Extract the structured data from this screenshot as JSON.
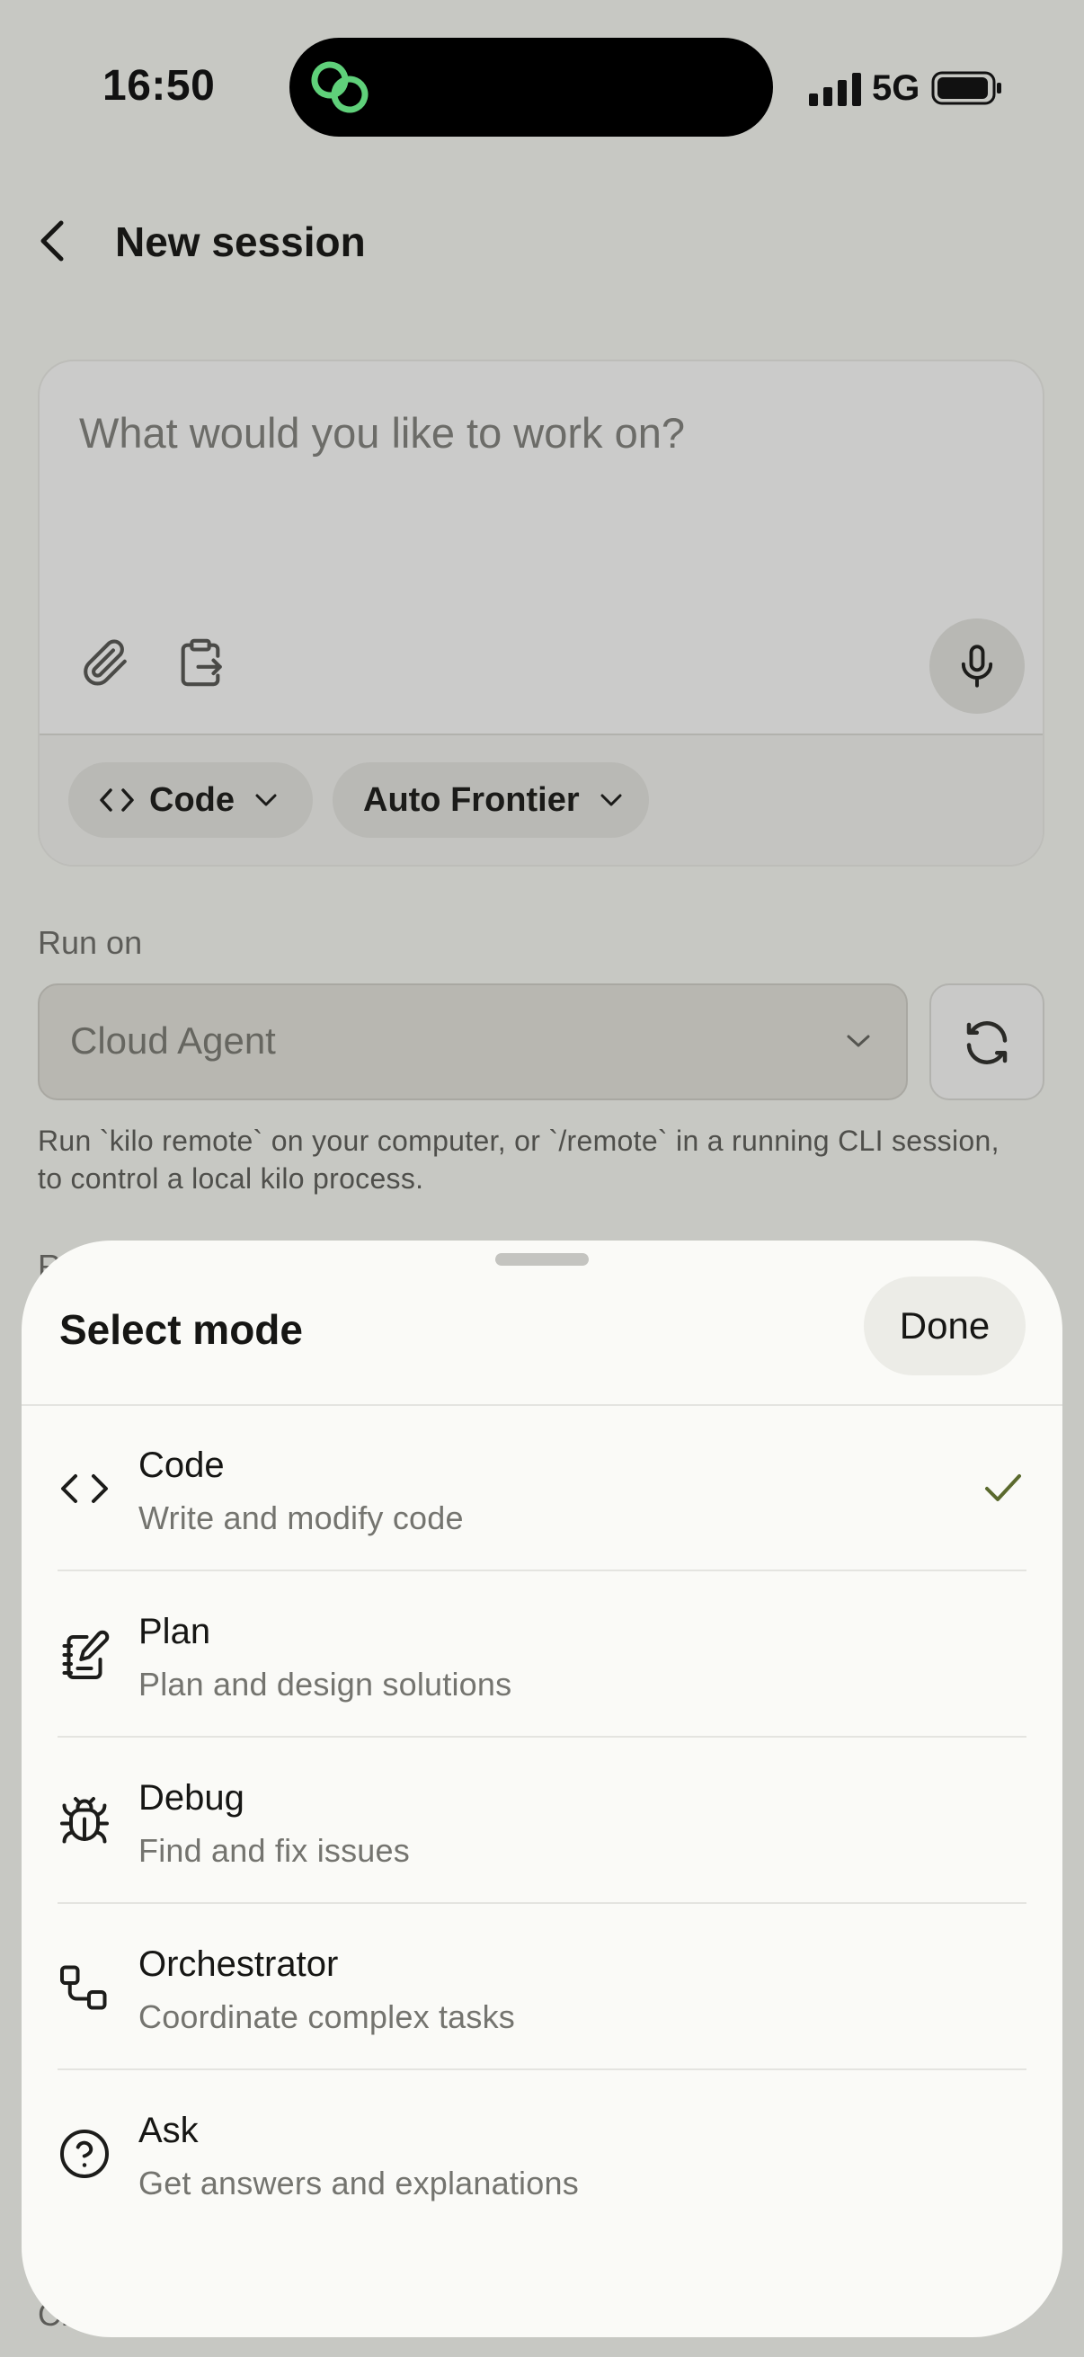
{
  "status_bar": {
    "time": "16:50",
    "network": "5G"
  },
  "header": {
    "title": "New session"
  },
  "composer": {
    "placeholder": "What would you like to work on?",
    "mode_chip": "Code",
    "model_chip": "Auto Frontier"
  },
  "run_on": {
    "label": "Run on",
    "selected": "Cloud Agent",
    "help_text": "Run `kilo remote` on your computer, or `/remote` in a running CLI session, to control a local kilo process.",
    "peek_label_top": "R",
    "peek_label_bottom": "Chang"
  },
  "sheet": {
    "title": "Select mode",
    "done_label": "Done",
    "modes": [
      {
        "name": "Code",
        "description": "Write and modify code",
        "icon": "code-icon",
        "selected": true
      },
      {
        "name": "Plan",
        "description": "Plan and design solutions",
        "icon": "plan-icon",
        "selected": false
      },
      {
        "name": "Debug",
        "description": "Find and fix issues",
        "icon": "bug-icon",
        "selected": false
      },
      {
        "name": "Orchestrator",
        "description": "Coordinate complex tasks",
        "icon": "orchestrator-icon",
        "selected": false
      },
      {
        "name": "Ask",
        "description": "Get answers and explanations",
        "icon": "help-circle-icon",
        "selected": false
      }
    ]
  },
  "colors": {
    "accent_check": "#5b6a2e",
    "island_icon": "#5fd07a",
    "background": "#c7c8c3",
    "sheet": "#fafaf7"
  }
}
